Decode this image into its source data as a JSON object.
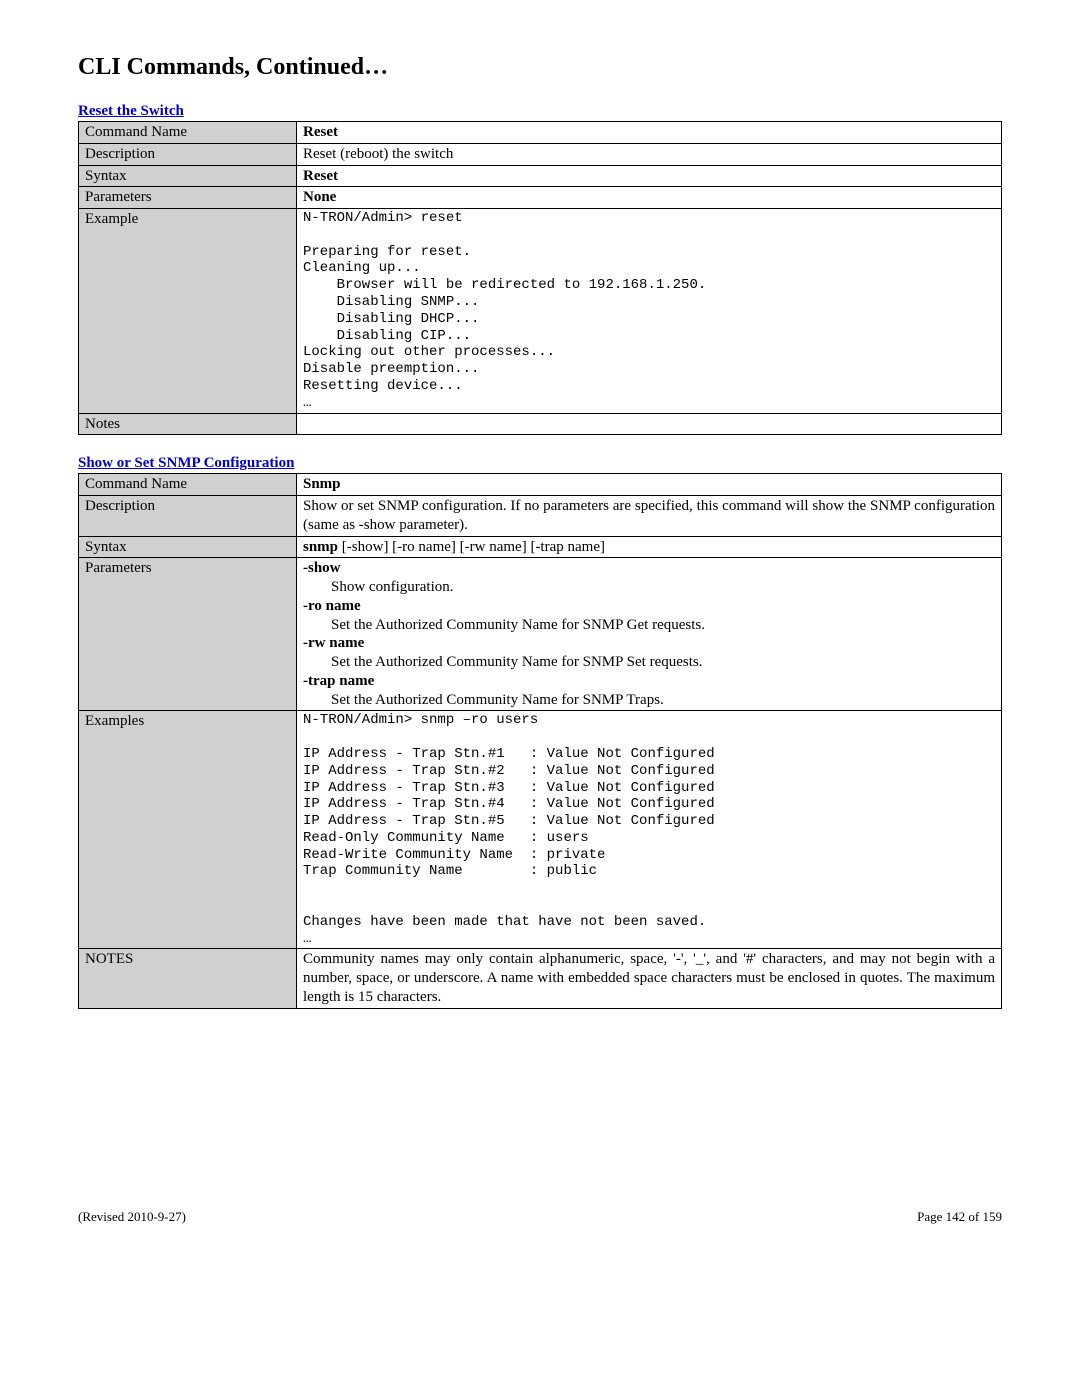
{
  "page_title": "CLI Commands, Continued…",
  "reset": {
    "heading": "Reset the Switch",
    "rows": {
      "cmd_label": "Command Name",
      "cmd_value": "Reset",
      "desc_label": "Description",
      "desc_value": "Reset (reboot) the switch",
      "syntax_label": "Syntax",
      "syntax_value": "Reset",
      "params_label": "Parameters",
      "params_value": "None",
      "example_label": "Example",
      "example_value": "N-TRON/Admin> reset\n\nPreparing for reset.\nCleaning up...\n    Browser will be redirected to 192.168.1.250.\n    Disabling SNMP...\n    Disabling DHCP...\n    Disabling CIP...\nLocking out other processes...\nDisable preemption...\nResetting device...\n…",
      "notes_label": "Notes",
      "notes_value": ""
    }
  },
  "snmp": {
    "heading": "Show or Set SNMP Configuration",
    "rows": {
      "cmd_label": "Command Name",
      "cmd_value": "Snmp",
      "desc_label": "Description",
      "desc_value": "Show or set SNMP configuration. If no parameters are specified, this command will show the SNMP configuration (same as -show parameter).",
      "syntax_label": "Syntax",
      "syntax_bold": "snmp",
      "syntax_rest": " [-show] [-ro name] [-rw name] [-trap name]",
      "params_label": "Parameters",
      "params": [
        {
          "head": "-show",
          "desc": "Show configuration."
        },
        {
          "head": "-ro name",
          "desc": "Set the Authorized Community Name for SNMP Get requests."
        },
        {
          "head": "-rw name",
          "desc": "Set the Authorized Community Name for SNMP Set requests."
        },
        {
          "head": "-trap name",
          "desc": "Set the Authorized Community Name for SNMP Traps."
        }
      ],
      "examples_label": "Examples",
      "examples_value": "N-TRON/Admin> snmp –ro users\n\nIP Address - Trap Stn.#1   : Value Not Configured\nIP Address - Trap Stn.#2   : Value Not Configured\nIP Address - Trap Stn.#3   : Value Not Configured\nIP Address - Trap Stn.#4   : Value Not Configured\nIP Address - Trap Stn.#5   : Value Not Configured\nRead-Only Community Name   : users\nRead-Write Community Name  : private\nTrap Community Name        : public\n\n\nChanges have been made that have not been saved.\n…",
      "notes_label": "NOTES",
      "notes_value": "Community names may only contain alphanumeric, space, '-', '_', and '#' characters, and may not begin with a number, space, or underscore. A name with embedded space characters must be enclosed in quotes. The maximum length is 15 characters."
    }
  },
  "footer": {
    "revised": "(Revised 2010-9-27)",
    "page": "Page 142 of 159"
  }
}
